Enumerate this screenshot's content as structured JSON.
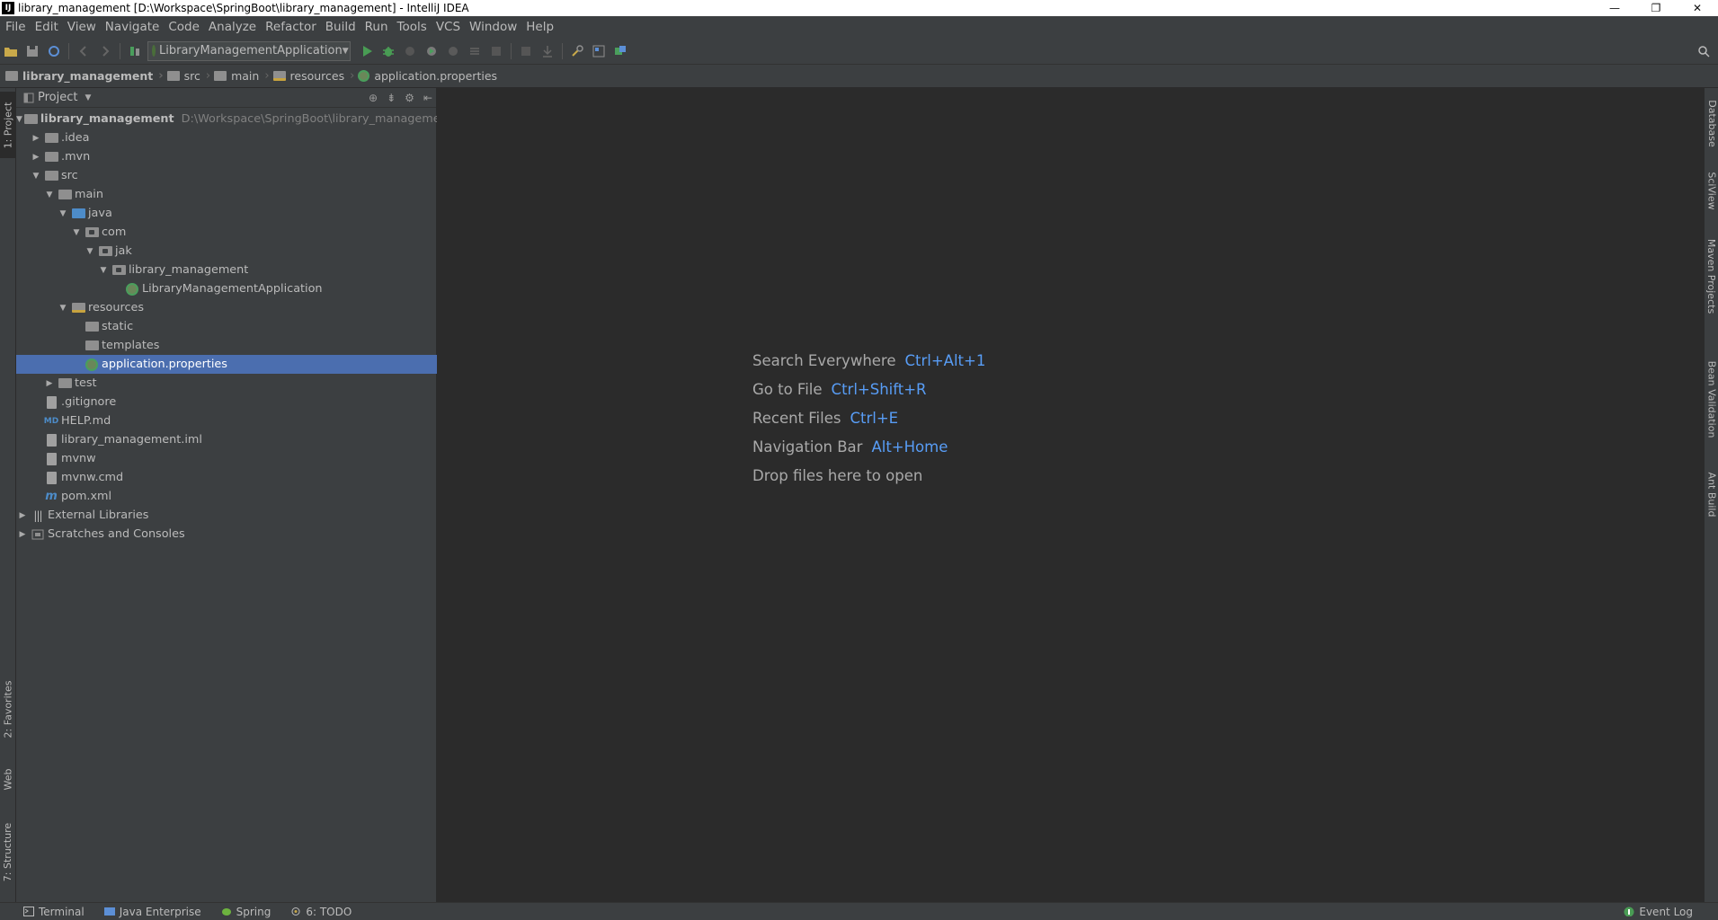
{
  "window": {
    "title": "library_management [D:\\Workspace\\SpringBoot\\library_management] - IntelliJ IDEA",
    "app_icon": "IJ",
    "controls": [
      "—",
      "❐",
      "✕"
    ]
  },
  "menu": [
    "File",
    "Edit",
    "View",
    "Navigate",
    "Code",
    "Analyze",
    "Refactor",
    "Build",
    "Run",
    "Tools",
    "VCS",
    "Window",
    "Help"
  ],
  "toolbar": {
    "run_config": "LibraryManagementApplication"
  },
  "breadcrumb": [
    "library_management",
    "src",
    "main",
    "resources",
    "application.properties"
  ],
  "project_panel": {
    "title": "Project",
    "tree": [
      {
        "label": "library_management",
        "path": "D:\\Workspace\\SpringBoot\\library_management"
      },
      {
        "label": ".idea"
      },
      {
        "label": ".mvn"
      },
      {
        "label": "src"
      },
      {
        "label": "main"
      },
      {
        "label": "java"
      },
      {
        "label": "com"
      },
      {
        "label": "jak"
      },
      {
        "label": "library_management"
      },
      {
        "label": "LibraryManagementApplication"
      },
      {
        "label": "resources"
      },
      {
        "label": "static"
      },
      {
        "label": "templates"
      },
      {
        "label": "application.properties"
      },
      {
        "label": "test"
      },
      {
        "label": ".gitignore"
      },
      {
        "label": "HELP.md"
      },
      {
        "label": "library_management.iml"
      },
      {
        "label": "mvnw"
      },
      {
        "label": "mvnw.cmd"
      },
      {
        "label": "pom.xml"
      },
      {
        "label": "External Libraries"
      },
      {
        "label": "Scratches and Consoles"
      }
    ]
  },
  "left_tabs": [
    "1: Project",
    "2: Favorites",
    "Web",
    "7: Structure"
  ],
  "right_tabs": [
    "Database",
    "SciView",
    "Maven Projects",
    "Bean Validation",
    "Ant Build"
  ],
  "editor_hints": [
    {
      "label": "Search Everywhere",
      "key": "Ctrl+Alt+1"
    },
    {
      "label": "Go to File",
      "key": "Ctrl+Shift+R"
    },
    {
      "label": "Recent Files",
      "key": "Ctrl+E"
    },
    {
      "label": "Navigation Bar",
      "key": "Alt+Home"
    },
    {
      "label": "Drop files here to open",
      "key": ""
    }
  ],
  "bottom_tabs": [
    "Terminal",
    "Java Enterprise",
    "Spring",
    "6: TODO"
  ],
  "event_log": "Event Log",
  "colors": {
    "selection": "#4b6eaf",
    "shortcut_key": "#589df6",
    "panel_bg": "#3c3f41",
    "editor_bg": "#2b2b2b"
  }
}
